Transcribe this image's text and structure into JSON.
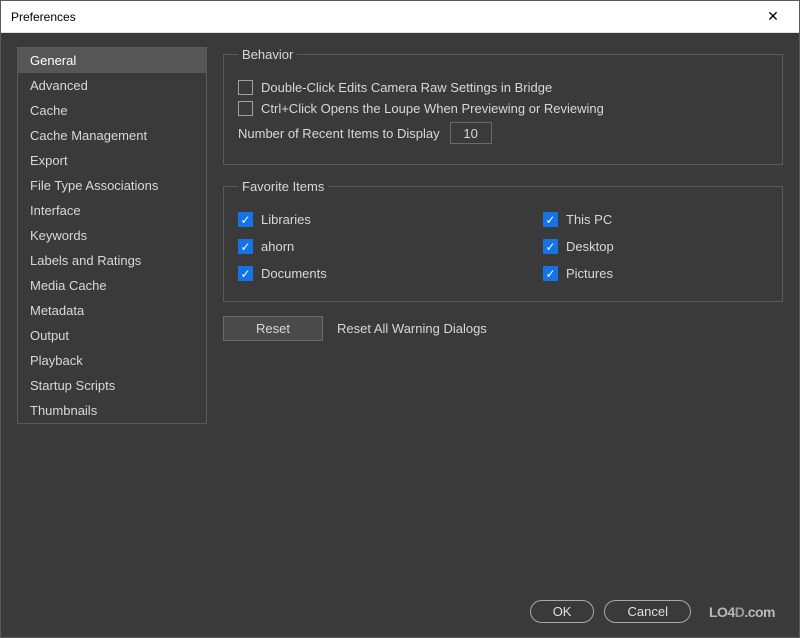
{
  "window": {
    "title": "Preferences"
  },
  "sidebar": {
    "items": [
      {
        "label": "General",
        "selected": true
      },
      {
        "label": "Advanced",
        "selected": false
      },
      {
        "label": "Cache",
        "selected": false
      },
      {
        "label": "Cache Management",
        "selected": false
      },
      {
        "label": "Export",
        "selected": false
      },
      {
        "label": "File Type Associations",
        "selected": false
      },
      {
        "label": "Interface",
        "selected": false
      },
      {
        "label": "Keywords",
        "selected": false
      },
      {
        "label": "Labels and Ratings",
        "selected": false
      },
      {
        "label": "Media Cache",
        "selected": false
      },
      {
        "label": "Metadata",
        "selected": false
      },
      {
        "label": "Output",
        "selected": false
      },
      {
        "label": "Playback",
        "selected": false
      },
      {
        "label": "Startup Scripts",
        "selected": false
      },
      {
        "label": "Thumbnails",
        "selected": false
      }
    ]
  },
  "behavior": {
    "legend": "Behavior",
    "doubleClick": {
      "label": "Double-Click Edits Camera Raw Settings in Bridge",
      "checked": false
    },
    "ctrlClick": {
      "label": "Ctrl+Click Opens the Loupe When Previewing or Reviewing",
      "checked": false
    },
    "recentItems": {
      "label": "Number of Recent Items to Display",
      "value": "10"
    }
  },
  "favorites": {
    "legend": "Favorite Items",
    "items": [
      {
        "label": "Libraries",
        "checked": true
      },
      {
        "label": "This PC",
        "checked": true
      },
      {
        "label": "ahorn",
        "checked": true
      },
      {
        "label": "Desktop",
        "checked": true
      },
      {
        "label": "Documents",
        "checked": true
      },
      {
        "label": "Pictures",
        "checked": true
      }
    ]
  },
  "reset": {
    "buttonLabel": "Reset",
    "description": "Reset All Warning Dialogs"
  },
  "footer": {
    "ok": "OK",
    "cancel": "Cancel",
    "watermark": "LO4D.com"
  }
}
